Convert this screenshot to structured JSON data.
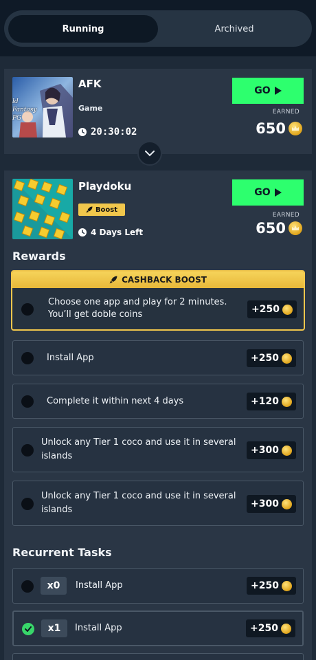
{
  "tabs": {
    "running": "Running",
    "archived": "Archived"
  },
  "afk": {
    "title": "AFK",
    "subtitle": "Game",
    "timer": "20:30:02",
    "go_label": "GO",
    "earned_label": "EARNED",
    "earned_value": "650",
    "thumb_text": "ld Fantasy PG"
  },
  "playdoku": {
    "title": "Playdoku",
    "badge": "Boost",
    "days_left": "4 Days Left",
    "go_label": "GO",
    "earned_label": "EARNED",
    "earned_value": "650"
  },
  "rewards": {
    "title": "Rewards",
    "cashback_title": "CASHBACK BOOST",
    "cashback_task": {
      "line1": "Choose one app and play for 2 minutes.",
      "line2": "You’ll get doble coins",
      "reward": "+250"
    },
    "tasks": [
      {
        "text": "Install App",
        "reward": "+250"
      },
      {
        "text": "Complete it within next 4 days",
        "reward": "+120"
      },
      {
        "line1": "Unlock any Tier 1 coco and use it in several",
        "line2": "islands",
        "reward": "+300"
      },
      {
        "line1": "Unlock any Tier 1 coco and use it in several",
        "line2": "islands",
        "reward": "+300"
      }
    ]
  },
  "recurrent": {
    "title": "Recurrent Tasks",
    "tasks": [
      {
        "mult": "x0",
        "text": "Install App",
        "reward": "+250",
        "done": false
      },
      {
        "mult": "x1",
        "text": "Install App",
        "reward": "+250",
        "done": true
      }
    ]
  },
  "colors": {
    "accent_green": "#2dff6e",
    "boost_gold": "#f1c74c",
    "background": "#1e2a38"
  }
}
